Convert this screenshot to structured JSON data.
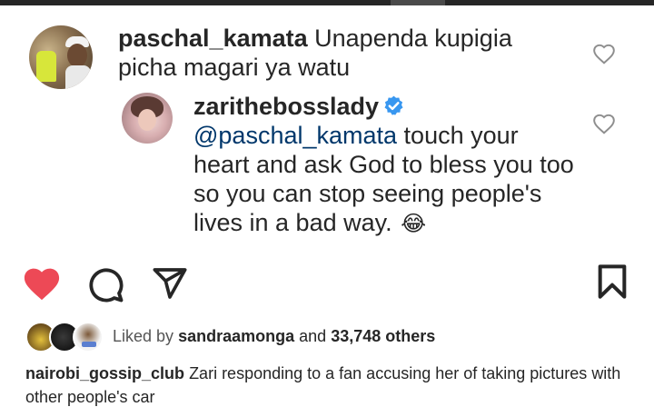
{
  "comments": [
    {
      "username": "paschal_kamata",
      "text": "Unapenda kupigia picha magari ya watu",
      "avatar_icon": "profile-avatar",
      "like_icon": "heart-outline-icon"
    },
    {
      "username": "zarithebosslady",
      "verified": true,
      "mention": "@paschal_kamata",
      "text": "touch your heart and ask God to bless you too so you can stop seeing people's lives in a bad way.",
      "emoji": "😂",
      "avatar_icon": "profile-avatar",
      "like_icon": "heart-outline-icon"
    }
  ],
  "actions": {
    "like_icon": "heart-filled-icon",
    "comment_icon": "comment-bubble-icon",
    "share_icon": "paper-plane-icon",
    "save_icon": "bookmark-icon",
    "like_color": "#ed4956"
  },
  "likes": {
    "prefix": "Liked by",
    "user": "sandraamonga",
    "conjunction": "and",
    "others": "33,748 others"
  },
  "caption": {
    "username": "nairobi_gossip_club",
    "text": "Zari responding to a fan accusing her of taking pictures with other people's car"
  },
  "colors": {
    "text": "#262626",
    "mention": "#00376b",
    "verified": "#3897f0",
    "like": "#ed4956"
  }
}
